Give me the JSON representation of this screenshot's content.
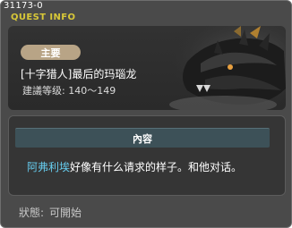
{
  "window": {
    "quest_id": "31173-0",
    "title": "QUEST INFO"
  },
  "quest": {
    "category": "主要",
    "name": "[十字猎人]最后的玛瑙龙",
    "level_label": "建議等级:",
    "level_range": "140～149"
  },
  "content": {
    "header": "內容",
    "npc_name": "阿弗利埃",
    "description": "好像有什么请求的样子。和他对话。"
  },
  "status": {
    "label": "狀態:",
    "value": "可開始"
  },
  "colors": {
    "window_bg": "#4a4a4a",
    "title": "#d8c838",
    "category_tag": "#b8a486",
    "content_header": "#3d5158",
    "npc_link": "#66ccee"
  }
}
